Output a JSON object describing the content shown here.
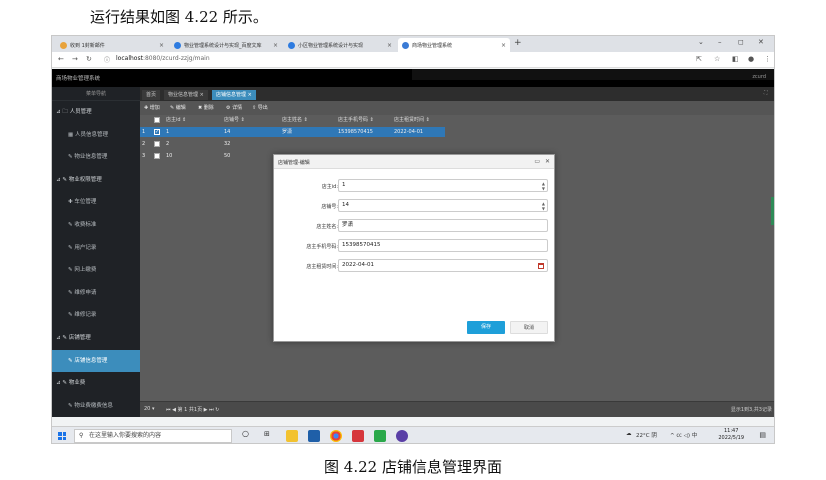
{
  "doc": {
    "caption_top": "运行结果如图 4.22 所示。",
    "caption_bottom": "图 4.22 店铺信息管理界面"
  },
  "browser": {
    "tabs": [
      {
        "label": "收到 1封新邮件",
        "icon_color": "#e8a23a"
      },
      {
        "label": "物业管理系统设计与实现_百度文库",
        "icon_color": "#2d7be0"
      },
      {
        "label": "小区物业管理系统设计与实现",
        "icon_color": "#2d7be0"
      },
      {
        "label": "商场物业管理系统",
        "icon_color": "#3a7bd5"
      }
    ],
    "new_tab": "+",
    "url_host": "localhost",
    "url_path": ":8080/zcurd-zzjg/main"
  },
  "app": {
    "title": "商场物业管理系统",
    "user": "zcurd"
  },
  "sidebar": {
    "title": "菜单导航",
    "items": [
      {
        "label": "⊿ 🗀 人员管理",
        "child": false,
        "active": false
      },
      {
        "label": "▦ 人员信息管理",
        "child": true,
        "active": false
      },
      {
        "label": "✎ 物业信息管理",
        "child": true,
        "active": false
      },
      {
        "label": "⊿ ✎ 物业权限管理",
        "child": false,
        "active": false
      },
      {
        "label": "✚ 车位管理",
        "child": true,
        "active": false
      },
      {
        "label": "✎ 收费标准",
        "child": true,
        "active": false
      },
      {
        "label": "✎ 用户记录",
        "child": true,
        "active": false
      },
      {
        "label": "✎ 网上缴费",
        "child": true,
        "active": false
      },
      {
        "label": "✎ 维修申请",
        "child": true,
        "active": false
      },
      {
        "label": "✎ 维修记录",
        "child": true,
        "active": false
      },
      {
        "label": "⊿ ✎ 店铺管理",
        "child": false,
        "active": false
      },
      {
        "label": "✎ 店铺信息管理",
        "child": true,
        "active": true
      },
      {
        "label": "⊿ ✎ 物业费",
        "child": false,
        "active": false
      },
      {
        "label": "✎ 物业费缴费信息",
        "child": true,
        "active": false
      }
    ]
  },
  "content": {
    "breadcrumbs": [
      "首页",
      "物业信息管理 ×",
      "店铺信息管理 ×"
    ],
    "toolbar": [
      "✚ 增加",
      "✎ 编辑",
      "✖ 删除",
      "⚙ 详情",
      "⇪ 导出"
    ],
    "columns": [
      "店主id ⇕",
      "店铺号 ⇕",
      "店主姓名 ⇕",
      "店主手机号码 ⇕",
      "店主租赁时间 ⇕"
    ],
    "rows": [
      {
        "num": "1",
        "id": "1",
        "shop": "14",
        "name": "罗潇",
        "phone": "15398570415",
        "date": "2022-04-01"
      },
      {
        "num": "2",
        "id": "2",
        "shop": "32",
        "name": "",
        "phone": "",
        "date": ""
      },
      {
        "num": "3",
        "id": "10",
        "shop": "50",
        "name": "",
        "phone": "",
        "date": ""
      }
    ],
    "pager": {
      "page_size": "20 ▾",
      "nav": "⏮ ◀ 第 1  共1页 ▶ ⏭ ↻",
      "info": "显示1到3,共3记录"
    }
  },
  "modal": {
    "title": "店铺管理-编辑",
    "fields": [
      {
        "label": "店主id:",
        "value": "1"
      },
      {
        "label": "店铺号:",
        "value": "14"
      },
      {
        "label": "店主姓名:",
        "value": "罗潇"
      },
      {
        "label": "店主手机号码:",
        "value": "15398570415"
      },
      {
        "label": "店主租赁时间:",
        "value": "2022-04-01"
      }
    ],
    "save": "保存",
    "cancel": "取消"
  },
  "taskbar": {
    "search_placeholder": "在这里输入你要搜索的内容",
    "weather": "22°C 阴",
    "tray": "^ ㏄ ◁) 中",
    "time": "11:47",
    "date": "2022/5/19"
  }
}
